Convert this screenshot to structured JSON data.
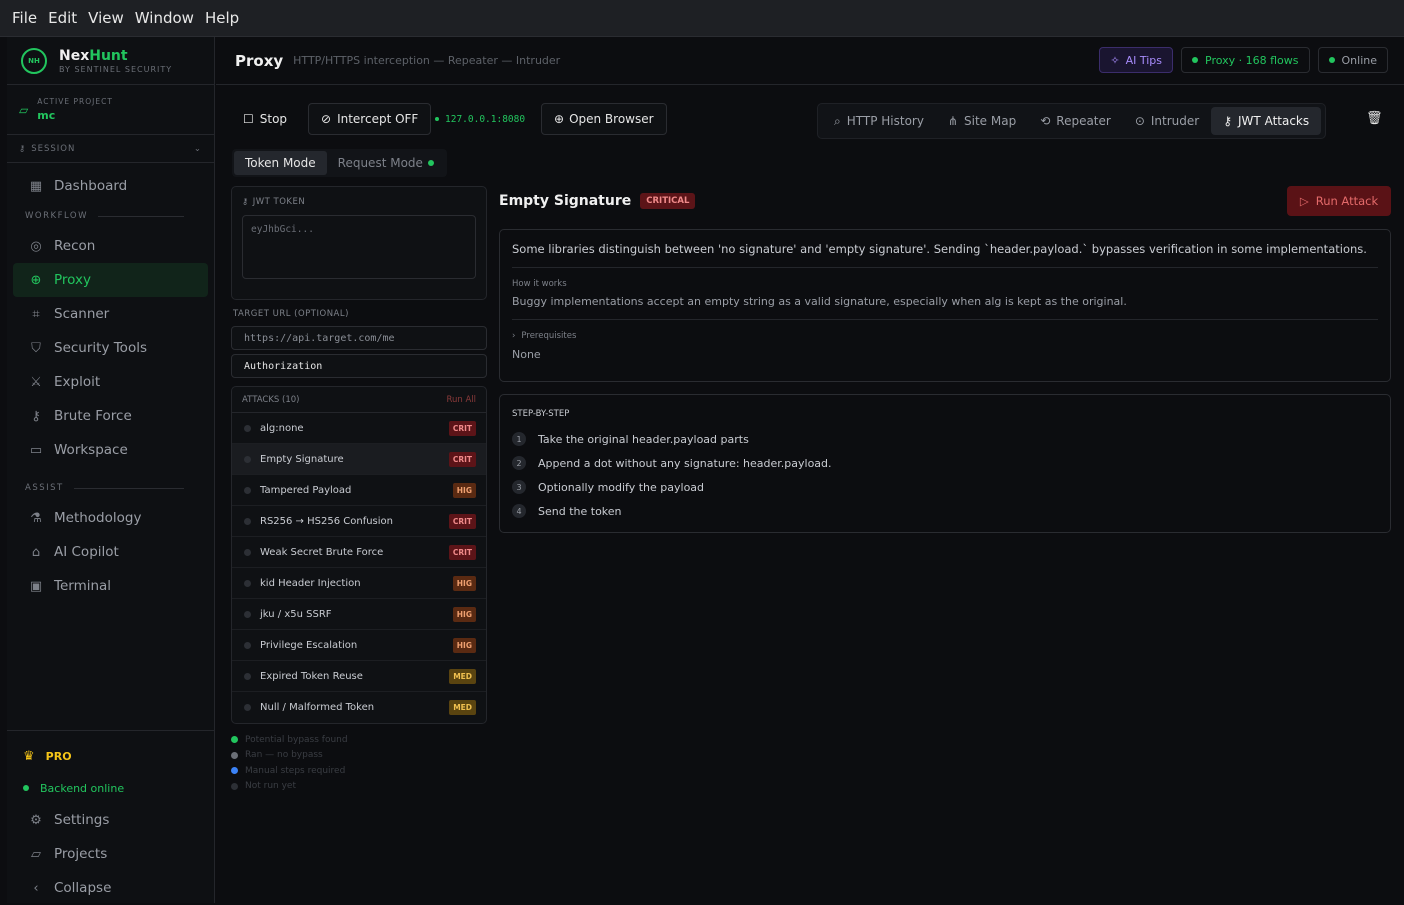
{
  "menubar": {
    "file": "File",
    "edit": "Edit",
    "view": "View",
    "window": "Window",
    "help": "Help"
  },
  "brand": {
    "name_a": "Nex",
    "name_b": "Hunt",
    "sub": "BY SENTINEL SECURITY",
    "mark": "NH"
  },
  "project": {
    "label": "ACTIVE PROJECT",
    "name": "mc"
  },
  "session": {
    "label": "SESSION"
  },
  "nav": {
    "dashboard": "Dashboard",
    "workflow_label": "WORKFLOW",
    "recon": "Recon",
    "proxy": "Proxy",
    "scanner": "Scanner",
    "security_tools": "Security Tools",
    "exploit": "Exploit",
    "brute_force": "Brute Force",
    "workspace": "Workspace",
    "assist_label": "ASSIST",
    "methodology": "Methodology",
    "ai_copilot": "AI Copilot",
    "terminal": "Terminal"
  },
  "sidebar_bottom": {
    "pro": "PRO",
    "backend": "Backend online",
    "settings": "Settings",
    "projects": "Projects",
    "collapse": "Collapse"
  },
  "header": {
    "title": "Proxy",
    "subtitle": "HTTP/HTTPS interception — Repeater — Intruder",
    "ai_tips": "AI Tips",
    "proxy_flows": "Proxy · 168 flows",
    "online": "Online"
  },
  "toolbar": {
    "stop": "Stop",
    "intercept": "Intercept OFF",
    "address": "127.0.0.1:8080",
    "open_browser": "Open Browser",
    "tabs": [
      "HTTP History",
      "Site Map",
      "Repeater",
      "Intruder",
      "JWT Attacks"
    ]
  },
  "modes": {
    "token": "Token Mode",
    "request": "Request Mode"
  },
  "jwt": {
    "label": "JWT TOKEN",
    "placeholder": "eyJhbGci..."
  },
  "target": {
    "label": "TARGET URL (OPTIONAL)",
    "url_placeholder": "https://api.target.com/me",
    "header_value": "Authorization"
  },
  "attacks": {
    "header": "ATTACKS (10)",
    "run_all": "Run All",
    "items": [
      {
        "name": "alg:none",
        "sev": "CRIT"
      },
      {
        "name": "Empty Signature",
        "sev": "CRIT"
      },
      {
        "name": "Tampered Payload",
        "sev": "HIG"
      },
      {
        "name": "RS256 → HS256 Confusion",
        "sev": "CRIT"
      },
      {
        "name": "Weak Secret Brute Force",
        "sev": "CRIT"
      },
      {
        "name": "kid Header Injection",
        "sev": "HIG"
      },
      {
        "name": "jku / x5u SSRF",
        "sev": "HIG"
      },
      {
        "name": "Privilege Escalation",
        "sev": "HIG"
      },
      {
        "name": "Expired Token Reuse",
        "sev": "MED"
      },
      {
        "name": "Null / Malformed Token",
        "sev": "MED"
      }
    ]
  },
  "legend": {
    "a": "Potential bypass found",
    "b": "Ran — no bypass",
    "c": "Manual steps required",
    "d": "Not run yet"
  },
  "detail": {
    "title": "Empty Signature",
    "severity": "CRITICAL",
    "run": "Run Attack",
    "description": "Some libraries distinguish between 'no signature' and 'empty signature'. Sending `header.payload.` bypasses verification in some implementations.",
    "how_label": "How it works",
    "how_text": "Buggy implementations accept an empty string as a valid signature, especially when alg is kept as the original.",
    "prereq_label": "Prerequisites",
    "prereq_value": "None",
    "steps_label": "STEP-BY-STEP",
    "steps": [
      "Take the original header.payload parts",
      "Append a dot without any signature: header.payload.",
      "Optionally modify the payload",
      "Send the token"
    ]
  },
  "colors": {
    "accent": "#22c55e",
    "critical": "#5c1418",
    "high": "#5a2a12",
    "medium": "#5a4410"
  }
}
